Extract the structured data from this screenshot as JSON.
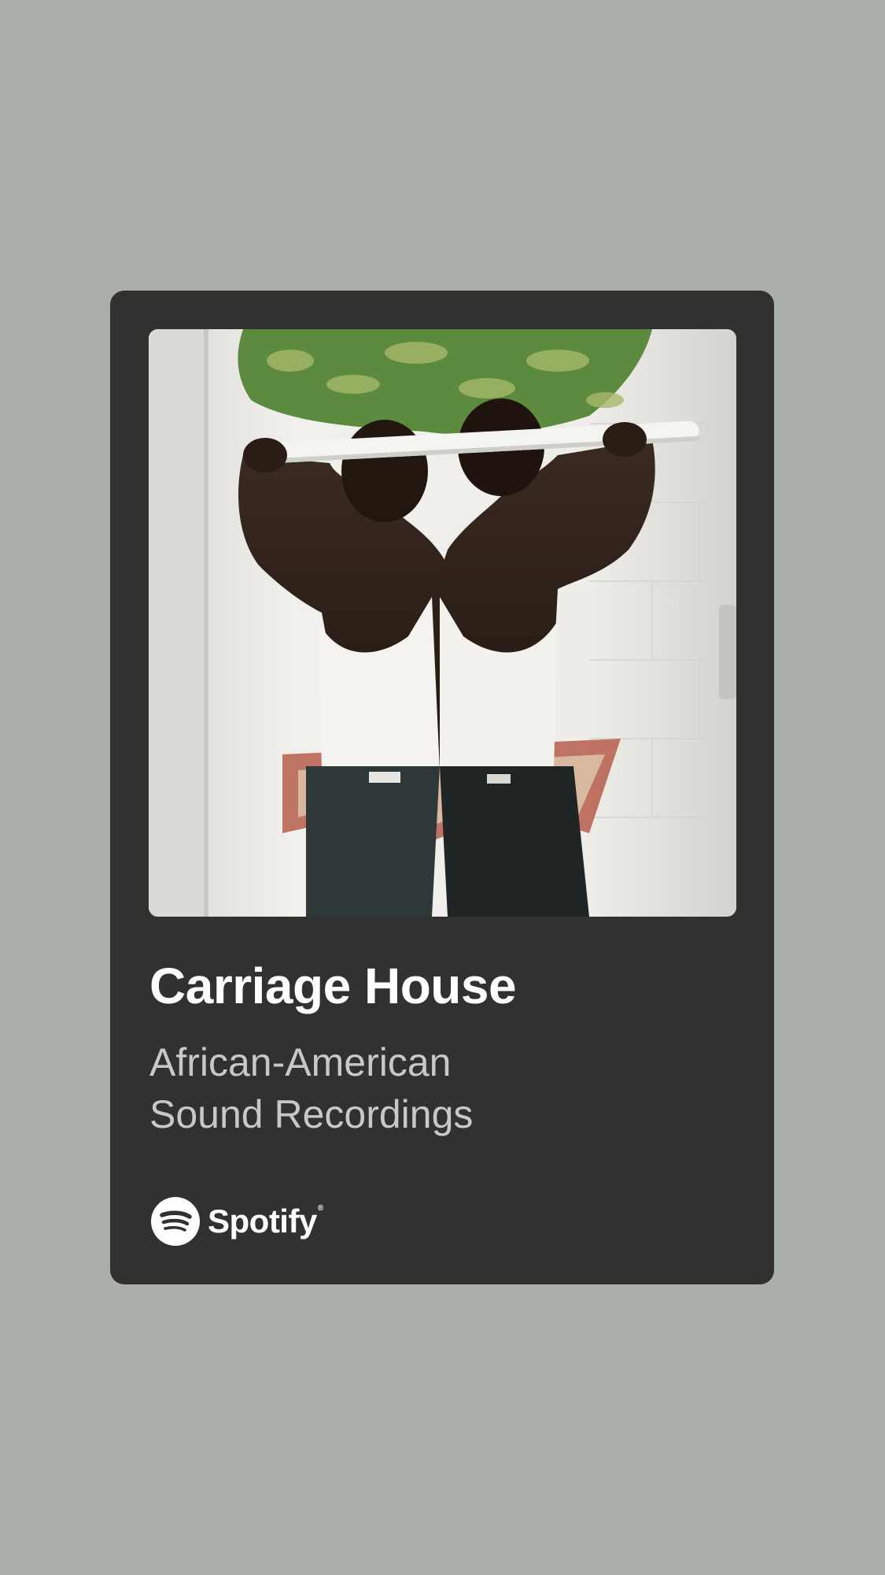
{
  "card": {
    "title": "Carriage House",
    "subtitle_lines": [
      "African-American",
      "Sound Recordings"
    ],
    "artwork": {
      "description_icon": "album-artwork"
    }
  },
  "brand": {
    "name": "Spotify",
    "registered_mark": "®",
    "icon": "spotify-logo-icon"
  },
  "colors": {
    "background": "#a8b0a8",
    "card": "#313230",
    "title": "#ffffff",
    "subtitle": "#c8c8c6"
  }
}
